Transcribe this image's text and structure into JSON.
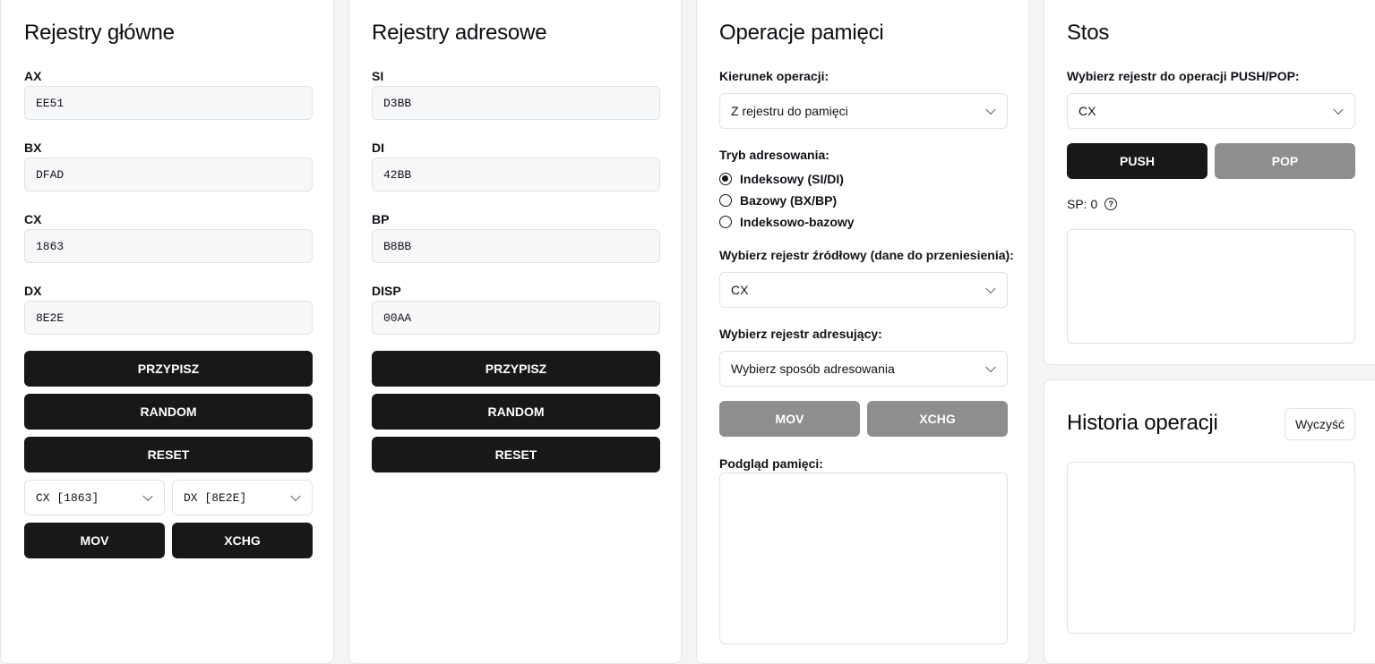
{
  "main_registers": {
    "title": "Rejestry główne",
    "fields": [
      {
        "label": "AX",
        "value": "EE51"
      },
      {
        "label": "BX",
        "value": "DFAD"
      },
      {
        "label": "CX",
        "value": "1863"
      },
      {
        "label": "DX",
        "value": "8E2E"
      }
    ],
    "assign_label": "PRZYPISZ",
    "random_label": "RANDOM",
    "reset_label": "RESET",
    "select_left": "CX [1863]",
    "select_right": "DX [8E2E]",
    "mov_label": "MOV",
    "xchg_label": "XCHG"
  },
  "address_registers": {
    "title": "Rejestry adresowe",
    "fields": [
      {
        "label": "SI",
        "value": "D3BB"
      },
      {
        "label": "DI",
        "value": "42BB"
      },
      {
        "label": "BP",
        "value": "B8BB"
      },
      {
        "label": "DISP",
        "value": "00AA"
      }
    ],
    "assign_label": "PRZYPISZ",
    "random_label": "RANDOM",
    "reset_label": "RESET"
  },
  "memory_ops": {
    "title": "Operacje pamięci",
    "direction_label": "Kierunek operacji:",
    "direction_value": "Z rejestru do pamięci",
    "mode_label": "Tryb adresowania:",
    "modes": [
      {
        "label": "Indeksowy (SI/DI)",
        "selected": true
      },
      {
        "label": "Bazowy (BX/BP)",
        "selected": false
      },
      {
        "label": "Indeksowo-bazowy",
        "selected": false
      }
    ],
    "source_label": "Wybierz rejestr źródłowy (dane do przeniesienia):",
    "source_value": "CX",
    "addressing_label": "Wybierz rejestr adresujący:",
    "addressing_value": "Wybierz sposób adresowania",
    "mov_label": "MOV",
    "xchg_label": "XCHG",
    "preview_label": "Podgląd pamięci:"
  },
  "stack": {
    "title": "Stos",
    "select_label": "Wybierz rejestr do operacji PUSH/POP:",
    "select_value": "CX",
    "push_label": "PUSH",
    "pop_label": "POP",
    "sp_text": "SP: 0",
    "help_glyph": "?"
  },
  "history": {
    "title": "Historia operacji",
    "clear_label": "Wyczyść"
  }
}
